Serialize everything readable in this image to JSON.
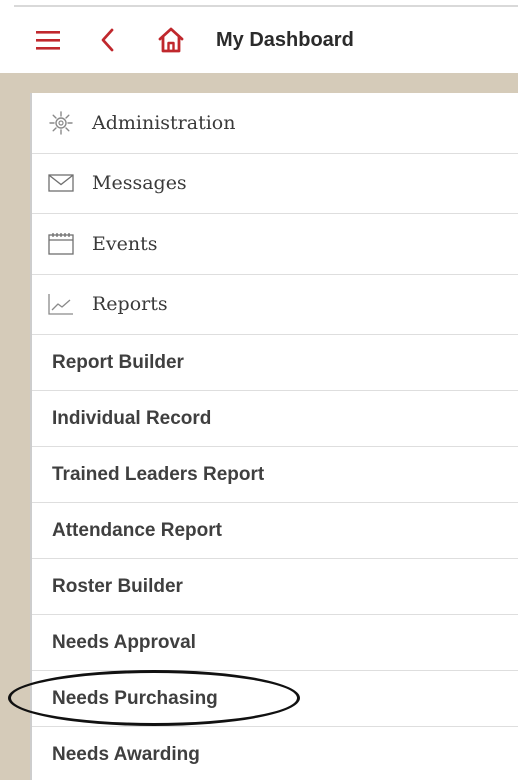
{
  "header": {
    "title": "My Dashboard",
    "accent_color": "#c0282d",
    "icons": {
      "menu": "hamburger-menu-icon",
      "back": "chevron-left-icon",
      "home": "home-icon"
    }
  },
  "menu": {
    "top_items": [
      {
        "label": "Administration",
        "icon": "gear-icon"
      },
      {
        "label": "Messages",
        "icon": "envelope-icon"
      },
      {
        "label": "Events",
        "icon": "calendar-icon"
      },
      {
        "label": "Reports",
        "icon": "line-chart-icon"
      }
    ],
    "report_items": [
      {
        "label": "Report Builder"
      },
      {
        "label": "Individual Record"
      },
      {
        "label": "Trained Leaders Report"
      },
      {
        "label": "Attendance Report"
      },
      {
        "label": "Roster Builder"
      },
      {
        "label": "Needs Approval"
      },
      {
        "label": "Needs Purchasing"
      },
      {
        "label": "Needs Awarding"
      }
    ]
  },
  "colors": {
    "background": "#d5cbb9",
    "panel": "#ffffff",
    "divider": "#dedede",
    "annotation": "#111111"
  }
}
